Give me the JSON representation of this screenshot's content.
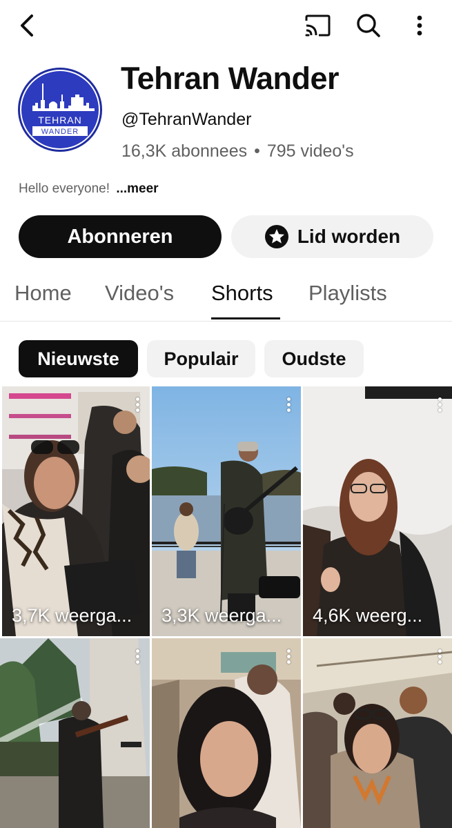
{
  "topbar": {
    "back_icon": "back-arrow-icon",
    "cast_icon": "cast-icon",
    "search_icon": "search-icon",
    "more_icon": "more-vertical-icon"
  },
  "channel": {
    "avatar_text_line1": "TEHRAN",
    "avatar_text_line2": "WANDER",
    "title": "Tehran Wander",
    "handle": "@TehranWander",
    "subscribers": "16,3K abonnees",
    "separator": "•",
    "videos": "795 video's",
    "description": "Hello everyone!",
    "more_label": "...meer"
  },
  "actions": {
    "subscribe_label": "Abonneren",
    "join_label": "Lid worden",
    "join_icon": "star-badge-icon"
  },
  "tabs": [
    {
      "label": "Home"
    },
    {
      "label": "Video's"
    },
    {
      "label": "Shorts",
      "active": true
    },
    {
      "label": "Playlists"
    }
  ],
  "chips": [
    {
      "label": "Nieuwste",
      "active": true
    },
    {
      "label": "Populair"
    },
    {
      "label": "Oudste"
    }
  ],
  "shorts": [
    {
      "views": "3,7K weerga..."
    },
    {
      "views": "3,3K weerga..."
    },
    {
      "views": "4,6K weerg..."
    },
    {
      "views": ""
    },
    {
      "views": ""
    },
    {
      "views": ""
    }
  ],
  "colors": {
    "brand_blue": "#2d3bbf",
    "text_primary": "#0f0f0f",
    "text_secondary": "#606060",
    "chip_bg": "#f2f2f2"
  }
}
